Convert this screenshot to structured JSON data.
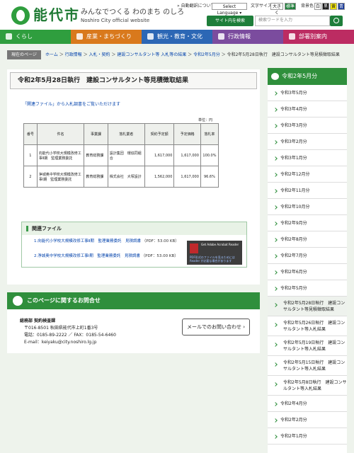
{
  "header": {
    "logo": "能代市",
    "catch": "みんなでつくる わのまち のしろ",
    "catch_en": "Noshiro City official website",
    "auto_translate": "» 自動翻訳について",
    "lang_select": "Select Language ▾",
    "text_size_label": "文字サイズ",
    "size_large": "大きく",
    "size_std": "標準",
    "bg_label": "背景色",
    "bg_options": [
      "白",
      "黒",
      "黄",
      "青"
    ],
    "search_label": "サイト内を検索",
    "search_placeholder": "検索ワードを入力"
  },
  "nav": [
    {
      "label": "くらし",
      "color": "#2f9e3e"
    },
    {
      "label": "産業・まちづくり",
      "color": "#d9791c"
    },
    {
      "label": "観光・教育・文化",
      "color": "#2c67b5"
    },
    {
      "label": "行政情報",
      "color": "#7b4c9e"
    },
    {
      "label": "部署別案内",
      "color": "#bc2c62"
    }
  ],
  "breadcrumb": {
    "label": "現在のページ",
    "items": [
      "ホーム",
      "行政情報",
      "入札・契約",
      "建設コンサルタント等 入札等の結果",
      "令和2年5月分",
      "令和2年5月28日執行　建設コンサルタント等見積徴取結果"
    ]
  },
  "main": {
    "title": "令和2年5月28日執行　建設コンサルタント等見積徴取結果",
    "intro": "「関連ファイル」から入札調書をご覧いただけます",
    "unit": "単位：円",
    "columns": [
      "番号",
      "件名",
      "事業課",
      "落札業者",
      "契約予定額",
      "予定価格",
      "落札率"
    ],
    "rows": [
      [
        "1",
        "向能代小学校大規模改修工事Ⅱ期　監理業務委託",
        "教育総務課",
        "設計集団　環協同組合",
        "1,617,000",
        "1,617,000",
        "100.0%"
      ],
      [
        "2",
        "浄城奥中学校大規模改修工事Ⅰ期　監理業務委託",
        "教育総務課",
        "株式会社　大塚設計",
        "1,562,000",
        "1,617,000",
        "96.6%"
      ]
    ]
  },
  "related": {
    "title": "関連ファイル",
    "files": [
      {
        "name": "1.向能代小学校大規模改修工事Ⅱ期　監理業務委託　見積調書",
        "info": "（PDF：53.00 KB）"
      },
      {
        "name": "2.浄城奥中学校大規模改修工事Ⅰ期　監理業務委託　見積調書",
        "info": "（PDF：53.00 KB）"
      }
    ],
    "ad_title": "Get Adobe Acrobat Reader",
    "ad_note": "PDF形式のファイルを見るためには Reader が必要な場合があります"
  },
  "contact": {
    "title": "このページに関するお問合せ",
    "dept": "総務部 契約検査課",
    "address": "〒016-8501 秋田県能代市上町1番3号",
    "tel": "電話：0185-89-2222 ／ FAX：0185-54-6460",
    "email": "E-mail：keiyaku@city.noshiro.lg.jp",
    "mail_button": "メールでのお問い合わせ ›"
  },
  "sidebar": {
    "title": "令和2年5月分",
    "items": [
      "令和3年5月分",
      "令和3年4月分",
      "令和3年3月分",
      "令和3年2月分",
      "令和3年1月分",
      "令和2年12月分",
      "令和2年11月分",
      "令和2年10月分",
      "令和2年9月分",
      "令和2年8月分",
      "令和2年7月分",
      "令和2年6月分",
      "令和2年5月分",
      "令和2年5月28日執行　建設コンサルタント等見積徴取結果",
      "令和2年5月26日執行　建設コンサルタント等入札結果",
      "令和2年5月19日執行　建設コンサルタント等入札結果",
      "令和2年5月15日執行　建設コンサルタント等入札結果",
      "令和2年5月8日執行　建設コンサルタント等入札結果",
      "令和2年4月分",
      "令和2年2月分",
      "令和2年1月分"
    ]
  }
}
